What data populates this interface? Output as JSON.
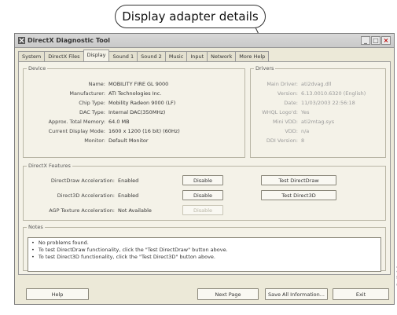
{
  "callout": {
    "label": "Display adapter details"
  },
  "window": {
    "title": "DirectX Diagnostic Tool",
    "controls": {
      "minimize": "_",
      "maximize": "□",
      "close": "×"
    }
  },
  "tabs": [
    "System",
    "DirectX Files",
    "Display",
    "Sound 1",
    "Sound 2",
    "Music",
    "Input",
    "Network",
    "More Help"
  ],
  "active_tab": "Display",
  "device": {
    "legend": "Device",
    "rows": [
      {
        "label": "Name:",
        "value": "MOBILITY FIRE GL 9000"
      },
      {
        "label": "Manufacturer:",
        "value": "ATI Technologies Inc."
      },
      {
        "label": "Chip Type:",
        "value": "Mobility Radeon 9000 (LF)"
      },
      {
        "label": "DAC Type:",
        "value": "Internal DAC(350MHz)"
      },
      {
        "label": "Approx. Total Memory:",
        "value": "64.0 MB"
      },
      {
        "label": "Current Display Mode:",
        "value": "1600 x 1200 (16 bit) (60Hz)"
      },
      {
        "label": "Monitor:",
        "value": "Default Monitor"
      }
    ]
  },
  "drivers": {
    "legend": "Drivers",
    "rows": [
      {
        "label": "Main Driver:",
        "value": "ati2dvag.dll"
      },
      {
        "label": "Version:",
        "value": "6.13.0010.6320 (English)"
      },
      {
        "label": "Date:",
        "value": "11/03/2003 22:56:18"
      },
      {
        "label": "WHQL Logo'd:",
        "value": "Yes"
      },
      {
        "label": "Mini VDD:",
        "value": "ati2mtag.sys"
      },
      {
        "label": "VDD:",
        "value": "n/a"
      },
      {
        "label": "DDI Version:",
        "value": "8"
      }
    ]
  },
  "directx": {
    "legend": "DirectX Features",
    "rows": [
      {
        "label": "DirectDraw Acceleration:",
        "value": "Enabled",
        "button": "Disable",
        "test": "Test DirectDraw"
      },
      {
        "label": "Direct3D Acceleration:",
        "value": "Enabled",
        "button": "Disable",
        "test": "Test Direct3D"
      },
      {
        "label": "AGP Texture Acceleration:",
        "value": "Not Available",
        "button": "Disable"
      }
    ]
  },
  "notes": {
    "legend": "Notes",
    "bullet": "•",
    "lines": [
      "No problems found.",
      "To test DirectDraw functionality, click the \"Test DirectDraw\" button above.",
      "To test Direct3D functionality, click the \"Test Direct3D\" button above."
    ]
  },
  "bottom": {
    "help": "Help",
    "next": "Next Page",
    "save": "Save All Information...",
    "exit": "Exit"
  },
  "side_code": "e5cd3p1-1"
}
